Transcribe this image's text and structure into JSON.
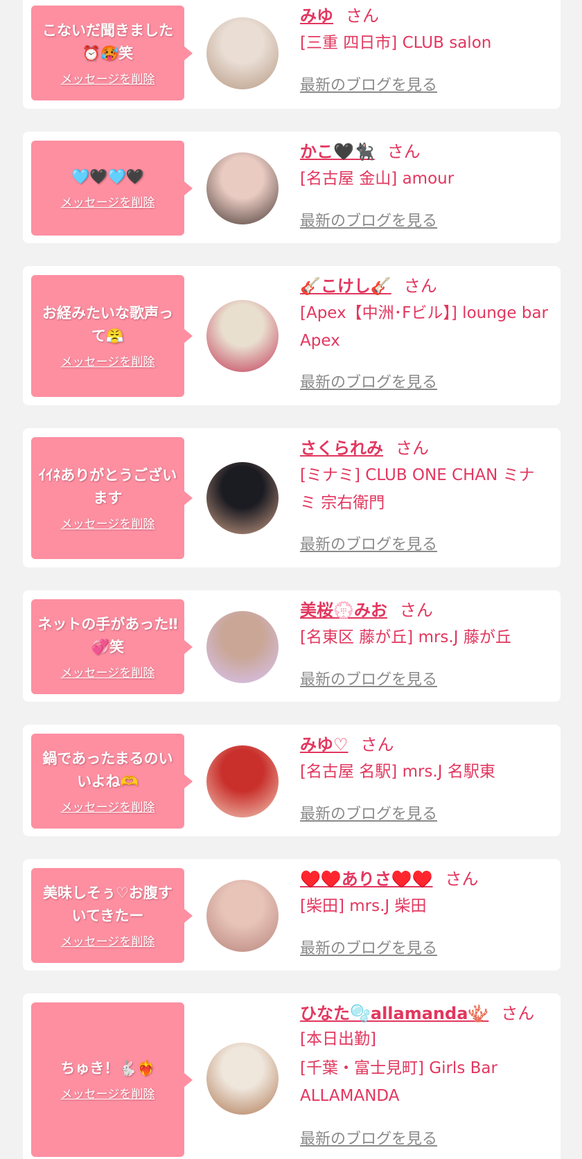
{
  "items": [
    {
      "message": "こないだ聞きました⏰🥵笑",
      "delete_label": "メッセージを削除",
      "name": "みゆ",
      "san": "さん",
      "shop_lines": [
        "[三重 四日市] CLUB salon"
      ],
      "blog_label": "最新のブログを見る",
      "avatar_colors": [
        "#e9ddd4",
        "#b79a84"
      ]
    },
    {
      "message": "🩵🖤🩵🖤",
      "delete_label": "メッセージを削除",
      "name": "かこ🖤🐈‍⬛",
      "san": "さん",
      "shop_lines": [
        "[名古屋 金山] amour"
      ],
      "blog_label": "最新のブログを見る",
      "avatar_colors": [
        "#e9cbc2",
        "#4a3b36"
      ]
    },
    {
      "message": "お経みたいな歌声って😤",
      "delete_label": "メッセージを削除",
      "name": "🎸こけし🎸",
      "san": "さん",
      "shop_lines": [
        "[Apex【中洲･Fビル】] lounge bar Apex"
      ],
      "blog_label": "最新のブログを見る",
      "avatar_colors": [
        "#e9dfcf",
        "#c23a57"
      ]
    },
    {
      "message": "ｲｲﾈありがとうございます",
      "delete_label": "メッセージを削除",
      "name": "さくられみ",
      "san": "さん",
      "shop_lines": [
        "[ミナミ] CLUB ONE CHAN ミナミ 宗右衛門"
      ],
      "blog_label": "最新のブログを見る",
      "avatar_colors": [
        "#1b1b22",
        "#c99d85"
      ]
    },
    {
      "message": "ネットの手があった‼︎💞笑",
      "delete_label": "メッセージを削除",
      "name": "美桜💮みお",
      "san": "さん",
      "shop_lines": [
        "[名東区 藤が丘] mrs.J 藤が丘"
      ],
      "blog_label": "最新のブログを見る",
      "avatar_colors": [
        "#c9a696",
        "#d9c3f3"
      ]
    },
    {
      "message": "鍋であったまるのいいよね🫶",
      "delete_label": "メッセージを削除",
      "name": "みゆ♡",
      "san": "さん",
      "shop_lines": [
        "[名古屋 名駅] mrs.J 名駅東"
      ],
      "blog_label": "最新のブログを見る",
      "avatar_colors": [
        "#c9302c",
        "#f1c8b8"
      ]
    },
    {
      "message": "美味しそぅ♡お腹すいてきたー",
      "delete_label": "メッセージを削除",
      "name": "♥️♥️ありさ♥️♥️",
      "san": "さん",
      "shop_lines": [
        "[柴田] mrs.J 柴田"
      ],
      "blog_label": "最新のブログを見る",
      "avatar_colors": [
        "#e7c3b8",
        "#b8857c"
      ]
    },
    {
      "message": "ちゅき！🐇❤️‍🔥",
      "delete_label": "メッセージを削除",
      "name": "ひなた🫧allamanda🪸",
      "san": "さん",
      "shop_lines": [
        "[本日出勤]",
        "[千葉・富士見町] Girls Bar ALLAMANDA"
      ],
      "blog_label": "最新のブログを見る",
      "avatar_colors": [
        "#efe6dc",
        "#b07a55"
      ]
    }
  ]
}
